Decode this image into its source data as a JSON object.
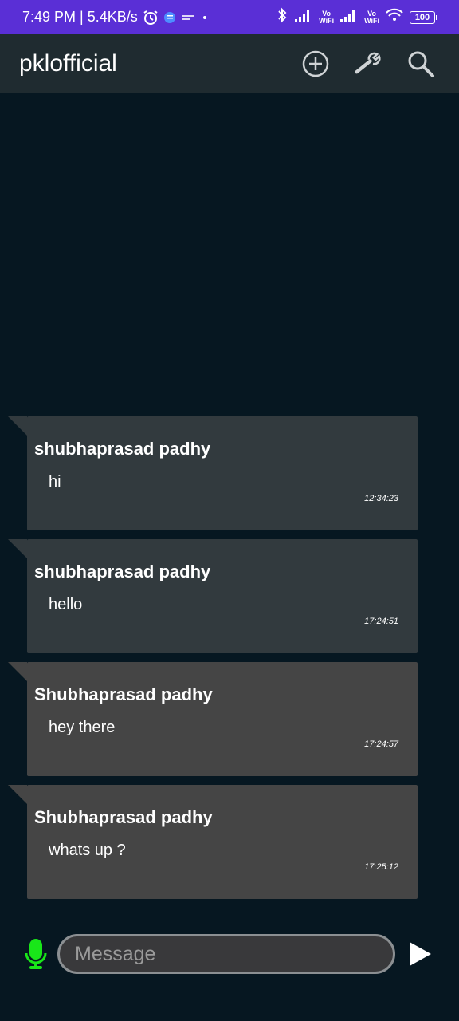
{
  "status_bar": {
    "time_speed": "7:49 PM | 5.4KB/s",
    "vo_wifi_1": "Vo\nWiFi",
    "vo_wifi_2": "Vo\nWiFi",
    "battery": "100",
    "icons": [
      "alarm-icon",
      "notification-app-icon",
      "small-app-icon",
      "dot-icon",
      "bluetooth-icon",
      "signal-icon",
      "wifi-icon",
      "battery-icon"
    ]
  },
  "app_bar": {
    "title": "pklofficial",
    "actions": [
      "add-icon",
      "wrench-icon",
      "search-icon"
    ]
  },
  "messages": [
    {
      "sender": "shubhaprasad padhy",
      "text": "hi",
      "time": "12:34:23"
    },
    {
      "sender": "shubhaprasad padhy",
      "text": "hello",
      "time": "17:24:51"
    },
    {
      "sender": "Shubhaprasad padhy",
      "text": "hey there",
      "time": "17:24:57"
    },
    {
      "sender": "Shubhaprasad padhy",
      "text": "whats up ?",
      "time": "17:25:12"
    }
  ],
  "composer": {
    "placeholder": "Message",
    "value": ""
  },
  "colors": {
    "status_bar": "#5a2fd6",
    "app_bar": "#1f2b30",
    "background": "#061721",
    "bubble_dark": "#323a3e",
    "bubble_grey": "#454545",
    "mic": "#19e619"
  }
}
